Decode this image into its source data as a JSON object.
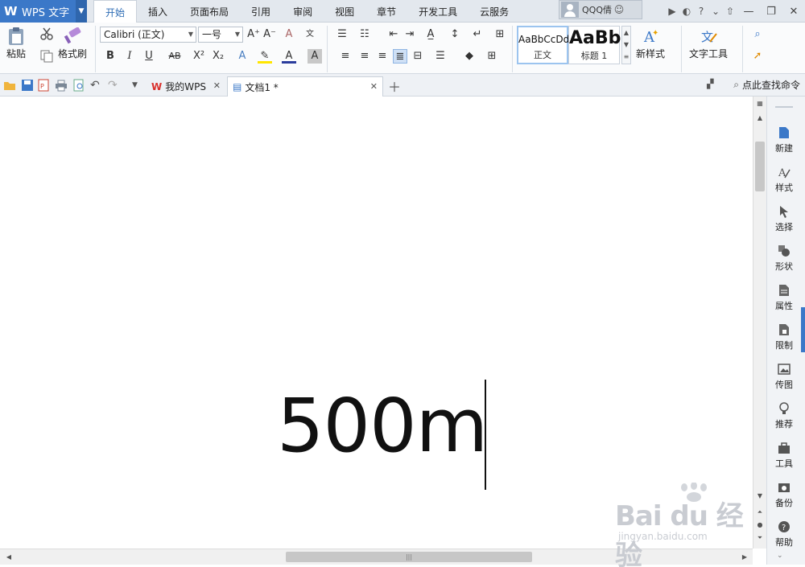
{
  "app": {
    "name": "WPS 文字"
  },
  "ribbon_tabs": [
    "开始",
    "插入",
    "页面布局",
    "引用",
    "审阅",
    "视图",
    "章节",
    "开发工具",
    "云服务"
  ],
  "user": {
    "name": "QQQ倩"
  },
  "ribbon": {
    "paste_label": "粘贴",
    "format_painter_label": "格式刷",
    "font_name": "Calibri (正文)",
    "font_size": "一号",
    "styles": [
      {
        "sample": "AaBbCcDd",
        "caption": "正文"
      },
      {
        "sample": "AaBb",
        "caption": "标题 1"
      }
    ],
    "new_style_label": "新样式",
    "text_tools_label": "文字工具"
  },
  "doc_tabs": [
    {
      "label": "我的WPS"
    },
    {
      "label": "文档1 *"
    }
  ],
  "search_command": "点此查找命令",
  "document": {
    "text": "500m"
  },
  "taskpane": [
    "新建",
    "样式",
    "选择",
    "形状",
    "属性",
    "限制",
    "传图",
    "推荐",
    "工具",
    "备份",
    "帮助"
  ],
  "watermark": {
    "big": "Bai du 经验",
    "small": "jingyan.baidu.com"
  },
  "colors": {
    "accent": "#3b78c8",
    "tab_active_text": "#2e6db5"
  }
}
